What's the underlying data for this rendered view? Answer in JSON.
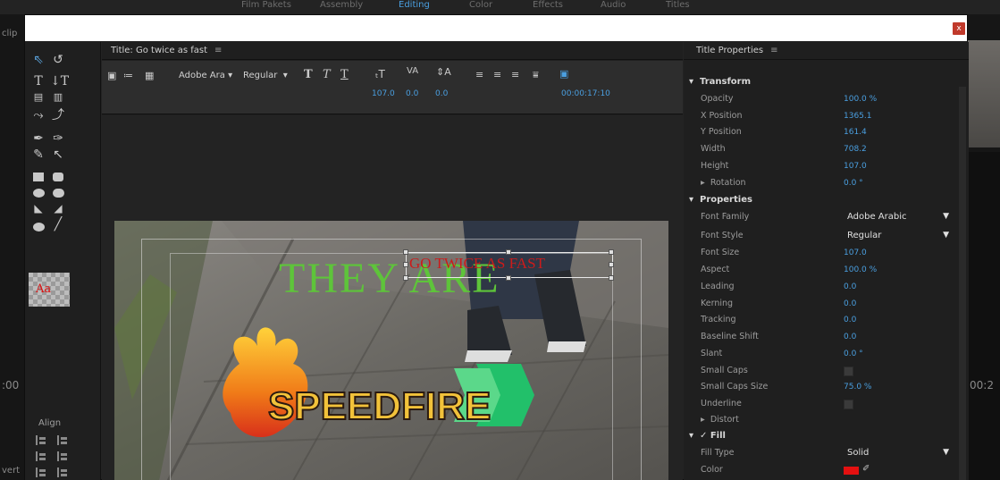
{
  "background_app": {
    "tabs": [
      "Film Pakets",
      "Assembly",
      "Editing",
      "Color",
      "Effects",
      "Audio",
      "Titles"
    ],
    "left_labels": [
      "clip",
      ":00",
      "vert"
    ],
    "right_label": "00:2"
  },
  "dialog": {
    "close_label": "x"
  },
  "tools": {
    "align_label": "Align"
  },
  "designer": {
    "title": "Title: Go twice as fast",
    "menu_icon": "≡",
    "toolbar": {
      "font_family": "Adobe Ara",
      "font_style": "Regular",
      "font_size": "107.0",
      "kerning": "0.0",
      "leading": "0.0",
      "timecode": "00:00:17:10"
    },
    "canvas": {
      "text_they_are": "THEY ARE",
      "text_go": "GO TWICE AS FAST",
      "logo_text": "SPEEDFIRE"
    }
  },
  "properties": {
    "title": "Title Properties",
    "menu_icon": "≡",
    "transform_label": "Transform",
    "opacity_label": "Opacity",
    "opacity": "100.0 %",
    "xpos_label": "X Position",
    "xpos": "1365.1",
    "ypos_label": "Y Position",
    "ypos": "161.4",
    "width_label": "Width",
    "width": "708.2",
    "height_label": "Height",
    "height": "107.0",
    "rotation_label": "Rotation",
    "rotation": "0.0 °",
    "properties_label": "Properties",
    "font_family_label": "Font Family",
    "font_family": "Adobe Arabic",
    "font_style_label": "Font Style",
    "font_style": "Regular",
    "font_size_label": "Font Size",
    "font_size": "107.0",
    "aspect_label": "Aspect",
    "aspect": "100.0 %",
    "leading_label": "Leading",
    "leading": "0.0",
    "kerning_label": "Kerning",
    "kerning": "0.0",
    "tracking_label": "Tracking",
    "tracking": "0.0",
    "baseline_label": "Baseline Shift",
    "baseline": "0.0",
    "slant_label": "Slant",
    "slant": "0.0 °",
    "small_caps_label": "Small Caps",
    "small_caps_size_label": "Small Caps Size",
    "small_caps_size": "75.0 %",
    "underline_label": "Underline",
    "distort_label": "Distort",
    "fill_label": "Fill",
    "fill_type_label": "Fill Type",
    "fill_type": "Solid",
    "color_label": "Color",
    "fill_color": "#e41010"
  }
}
